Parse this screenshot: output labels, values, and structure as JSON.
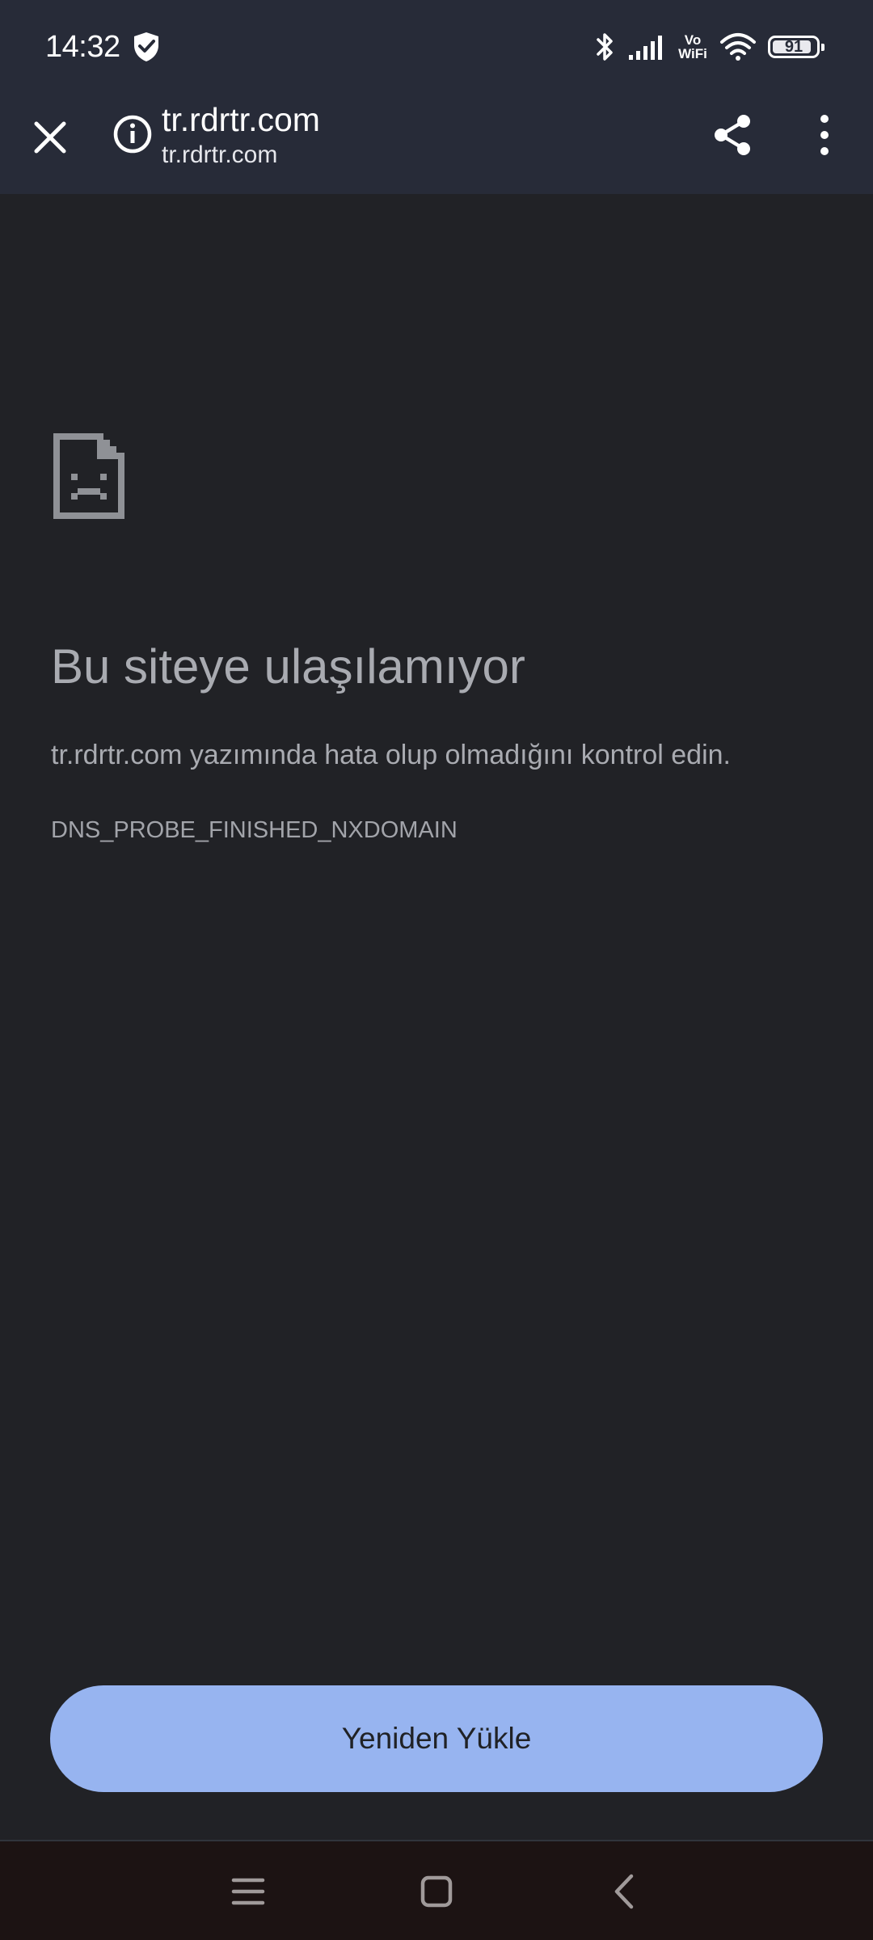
{
  "status_bar": {
    "time": "14:32",
    "vowifi_line1": "Vo",
    "vowifi_line2": "WiFi",
    "battery_level": "91",
    "battery_fraction": 0.91,
    "icons": [
      "shield-check-icon",
      "bluetooth-icon",
      "cellular-signal-icon",
      "vowifi-icon",
      "wifi-icon",
      "battery-icon"
    ]
  },
  "app_bar": {
    "title": "tr.rdrtr.com",
    "subtitle": "tr.rdrtr.com",
    "icons": [
      "close-icon",
      "info-icon",
      "share-icon",
      "more-vert-icon"
    ]
  },
  "error": {
    "icon": "sad-page-icon",
    "title": "Bu siteye ulaşılamıyor",
    "description": "tr.rdrtr.com yazımında hata olup olmadığını kontrol edin.",
    "code": "DNS_PROBE_FINISHED_NXDOMAIN"
  },
  "actions": {
    "reload_label": "Yeniden Yükle"
  },
  "nav_bar": {
    "icons": [
      "menu-icon",
      "home-icon",
      "back-icon"
    ]
  },
  "colors": {
    "background": "#212226",
    "app_bar": "#272b38",
    "button": "#97b4f0",
    "text_muted": "#a9abb1"
  }
}
